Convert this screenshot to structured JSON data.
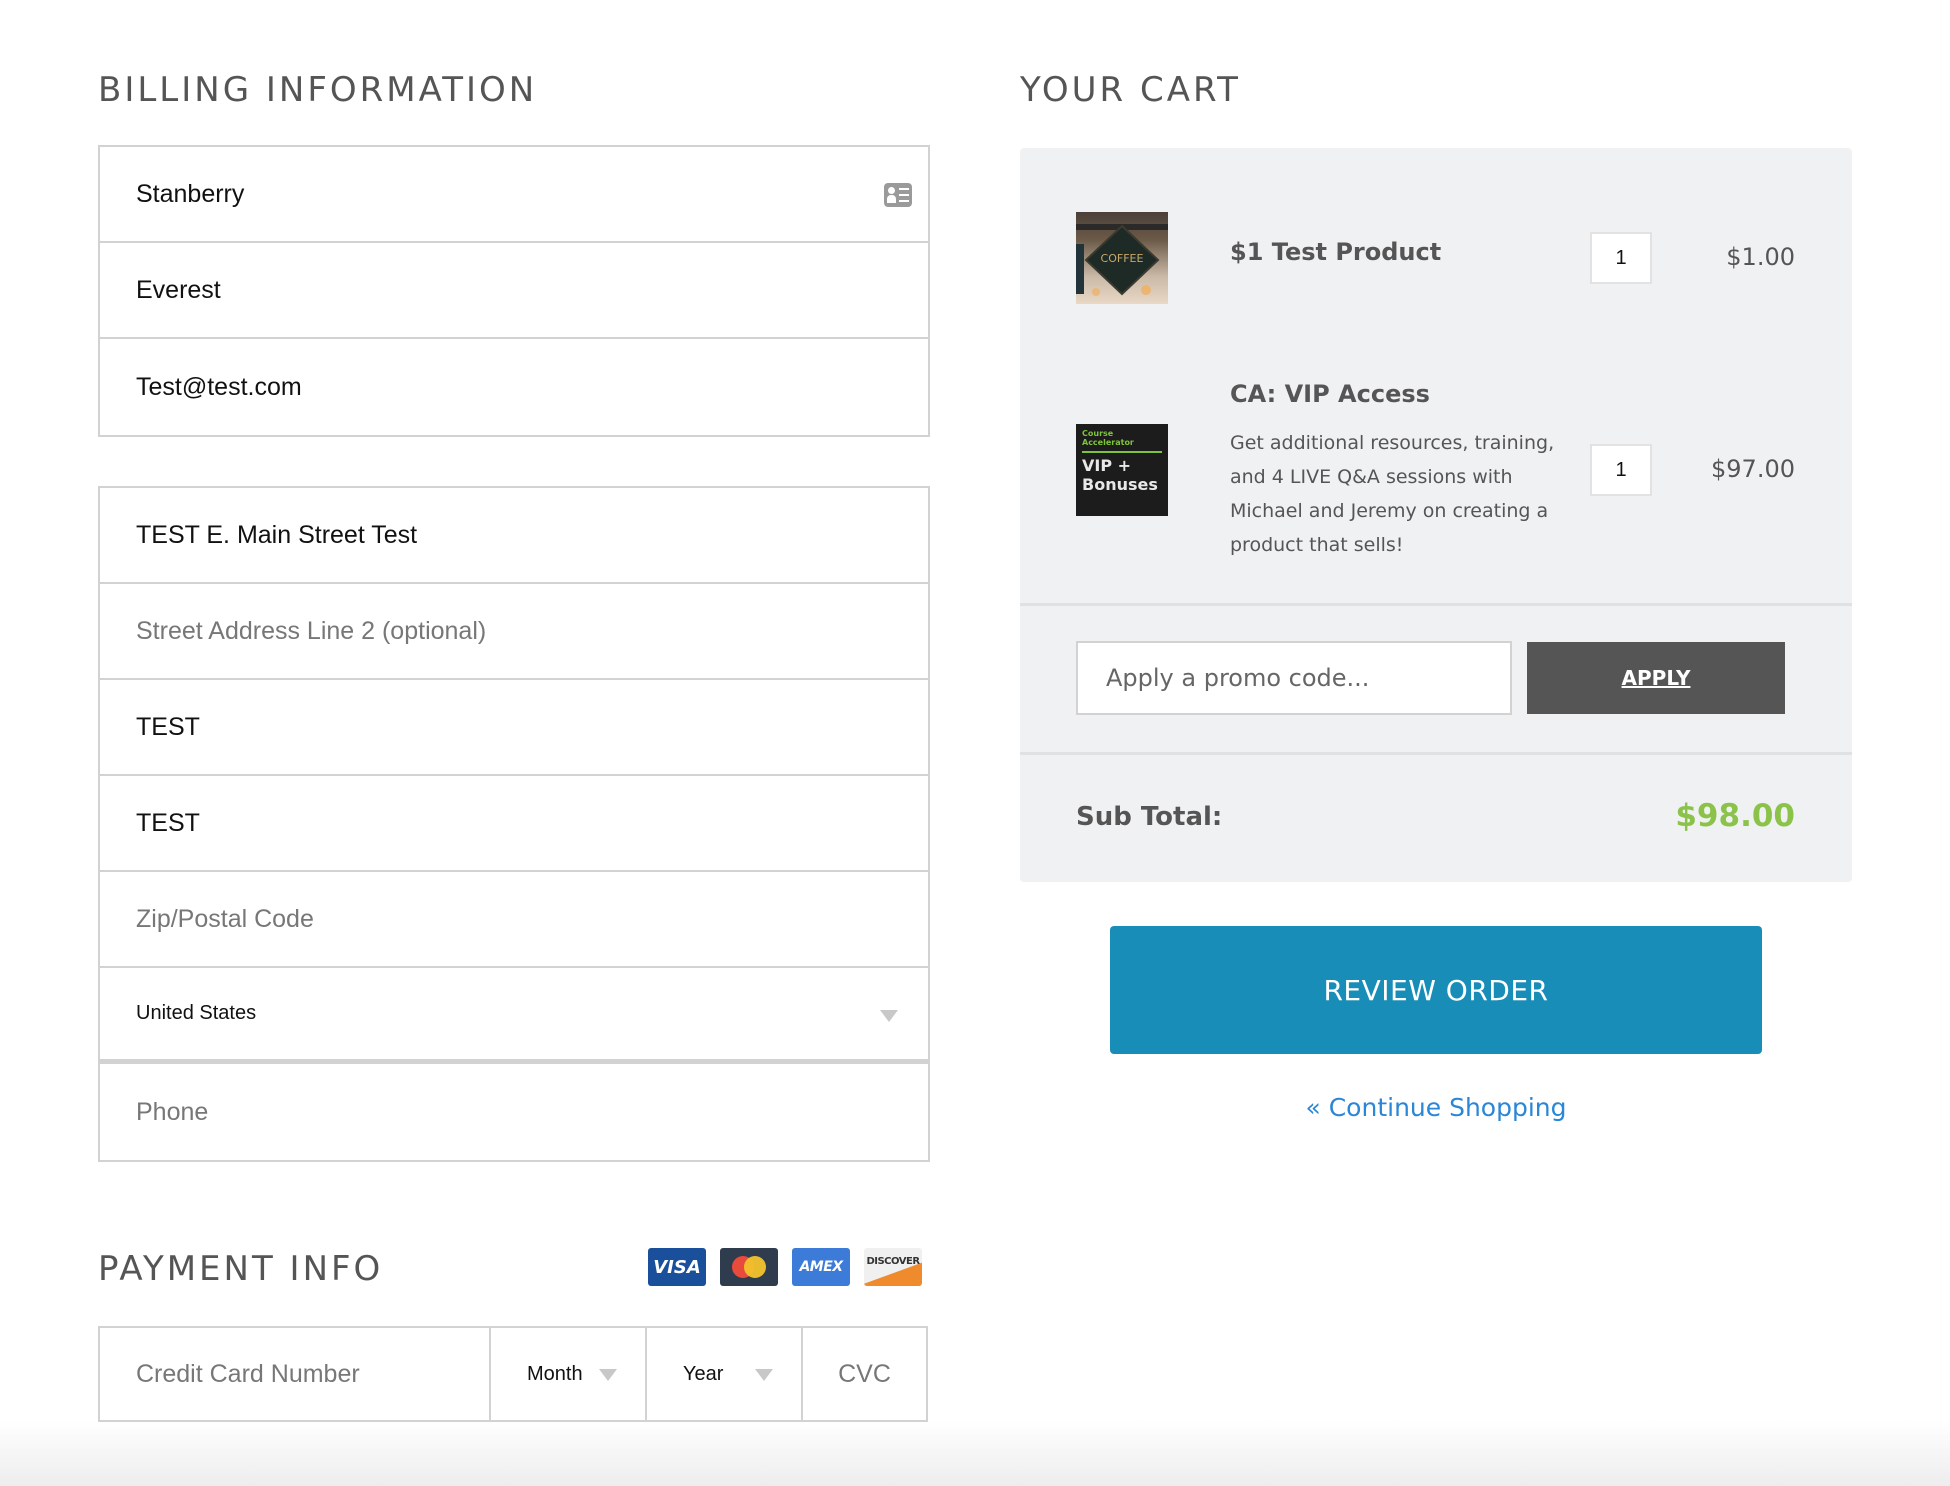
{
  "billing": {
    "title": "BILLING INFORMATION",
    "contact_fields": [
      {
        "name": "last-name",
        "value": "Stanberry",
        "placeholder": ""
      },
      {
        "name": "first-name",
        "value": "Everest",
        "placeholder": ""
      },
      {
        "name": "email",
        "value": "Test@test.com",
        "placeholder": ""
      }
    ],
    "address_fields": [
      {
        "name": "street-address",
        "value": "TEST E. Main Street Test",
        "placeholder": ""
      },
      {
        "name": "street-address-2",
        "value": "",
        "placeholder": "Street Address Line 2 (optional)"
      },
      {
        "name": "city",
        "value": "TEST",
        "placeholder": ""
      },
      {
        "name": "state",
        "value": "TEST",
        "placeholder": ""
      },
      {
        "name": "zip",
        "value": "",
        "placeholder": "Zip/Postal Code"
      }
    ],
    "country": {
      "selected": "United States"
    },
    "phone": {
      "value": "",
      "placeholder": "Phone"
    }
  },
  "payment": {
    "title": "PAYMENT INFO",
    "card_brands": [
      "VISA",
      "MC",
      "AMEX",
      "DISCOVER"
    ],
    "card_number_placeholder": "Credit Card Number",
    "month": "Month",
    "year": "Year",
    "cvc_placeholder": "CVC"
  },
  "cart": {
    "title": "YOUR CART",
    "items": [
      {
        "name": "$1 Test Product",
        "description": "",
        "qty": "1",
        "price": "$1.00",
        "image_text": "COFFEE"
      },
      {
        "name": "CA: VIP Access",
        "description": "Get additional resources, training, and 4 LIVE Q&A sessions with Michael and Jeremy on creating a product that sells!",
        "qty": "1",
        "price": "$97.00",
        "image_text": {
          "line1": "Course",
          "line2": "Accelerator",
          "line3": "VIP +",
          "line4": "Bonuses"
        }
      }
    ],
    "promo_placeholder": "Apply a promo code...",
    "apply_label": "APPLY",
    "subtotal_label": "Sub Total:",
    "subtotal_value": "$98.00",
    "subtotal_color": "#8bc34a",
    "review_label": "REVIEW ORDER",
    "review_color": "#188db8",
    "continue_label": "« Continue Shopping"
  }
}
